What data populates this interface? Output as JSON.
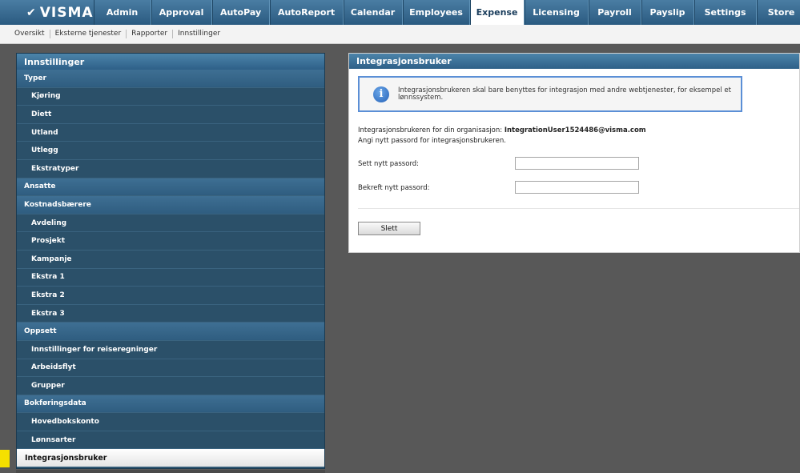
{
  "brand": {
    "logo_text": "VISMA"
  },
  "nav": {
    "items": [
      {
        "label": "Admin",
        "active": false
      },
      {
        "label": "Approval",
        "active": false
      },
      {
        "label": "AutoPay",
        "active": false
      },
      {
        "label": "AutoReport",
        "active": false
      },
      {
        "label": "Calendar",
        "active": false
      },
      {
        "label": "Employees",
        "active": false
      },
      {
        "label": "Expense",
        "active": true
      },
      {
        "label": "Licensing",
        "active": false
      },
      {
        "label": "Payroll",
        "active": false
      },
      {
        "label": "Payslip",
        "active": false
      },
      {
        "label": "Settings",
        "active": false
      },
      {
        "label": "Store",
        "active": false
      }
    ]
  },
  "subnav": {
    "items": [
      "Oversikt",
      "Eksterne tjenester",
      "Rapporter",
      "Innstillinger"
    ]
  },
  "sidebar": {
    "title": "Innstillinger",
    "rows": [
      {
        "label": "Typer",
        "kind": "section"
      },
      {
        "label": "Kjøring",
        "kind": "item"
      },
      {
        "label": "Diett",
        "kind": "item"
      },
      {
        "label": "Utland",
        "kind": "item"
      },
      {
        "label": "Utlegg",
        "kind": "item"
      },
      {
        "label": "Ekstratyper",
        "kind": "item"
      },
      {
        "label": "Ansatte",
        "kind": "section"
      },
      {
        "label": "Kostnadsbærere",
        "kind": "section"
      },
      {
        "label": "Avdeling",
        "kind": "item"
      },
      {
        "label": "Prosjekt",
        "kind": "item"
      },
      {
        "label": "Kampanje",
        "kind": "item"
      },
      {
        "label": "Ekstra 1",
        "kind": "item"
      },
      {
        "label": "Ekstra 2",
        "kind": "item"
      },
      {
        "label": "Ekstra 3",
        "kind": "item"
      },
      {
        "label": "Oppsett",
        "kind": "section"
      },
      {
        "label": "Innstillinger for reiseregninger",
        "kind": "item"
      },
      {
        "label": "Arbeidsflyt",
        "kind": "item"
      },
      {
        "label": "Grupper",
        "kind": "item"
      },
      {
        "label": "Bokføringsdata",
        "kind": "section"
      },
      {
        "label": "Hovedbokskonto",
        "kind": "item"
      },
      {
        "label": "Lønnsarter",
        "kind": "item"
      },
      {
        "label": "Integrasjonsbruker",
        "kind": "selected"
      }
    ]
  },
  "main": {
    "title": "Integrasjonsbruker",
    "info_icon": "info-icon",
    "info_text": "Integrasjonsbrukeren skal bare benyttes for integrasjon med andre webtjenester, for eksempel et lønnssystem.",
    "org_prefix": "Integrasjonsbrukeren for din organisasjon:",
    "org_user": "IntegrationUser1524486@visma.com",
    "hint": "Angi nytt passord for integrasjonsbrukeren.",
    "new_password_label": "Sett nytt passord:",
    "new_password_value": "",
    "confirm_password_label": "Bekreft nytt passord:",
    "confirm_password_value": "",
    "delete_button": "Slett"
  },
  "colors": {
    "nav_bg": "#2a5a80",
    "sidebar_bg": "#2c526c",
    "info_border": "#5b8fd6",
    "page_bg": "#585858"
  }
}
